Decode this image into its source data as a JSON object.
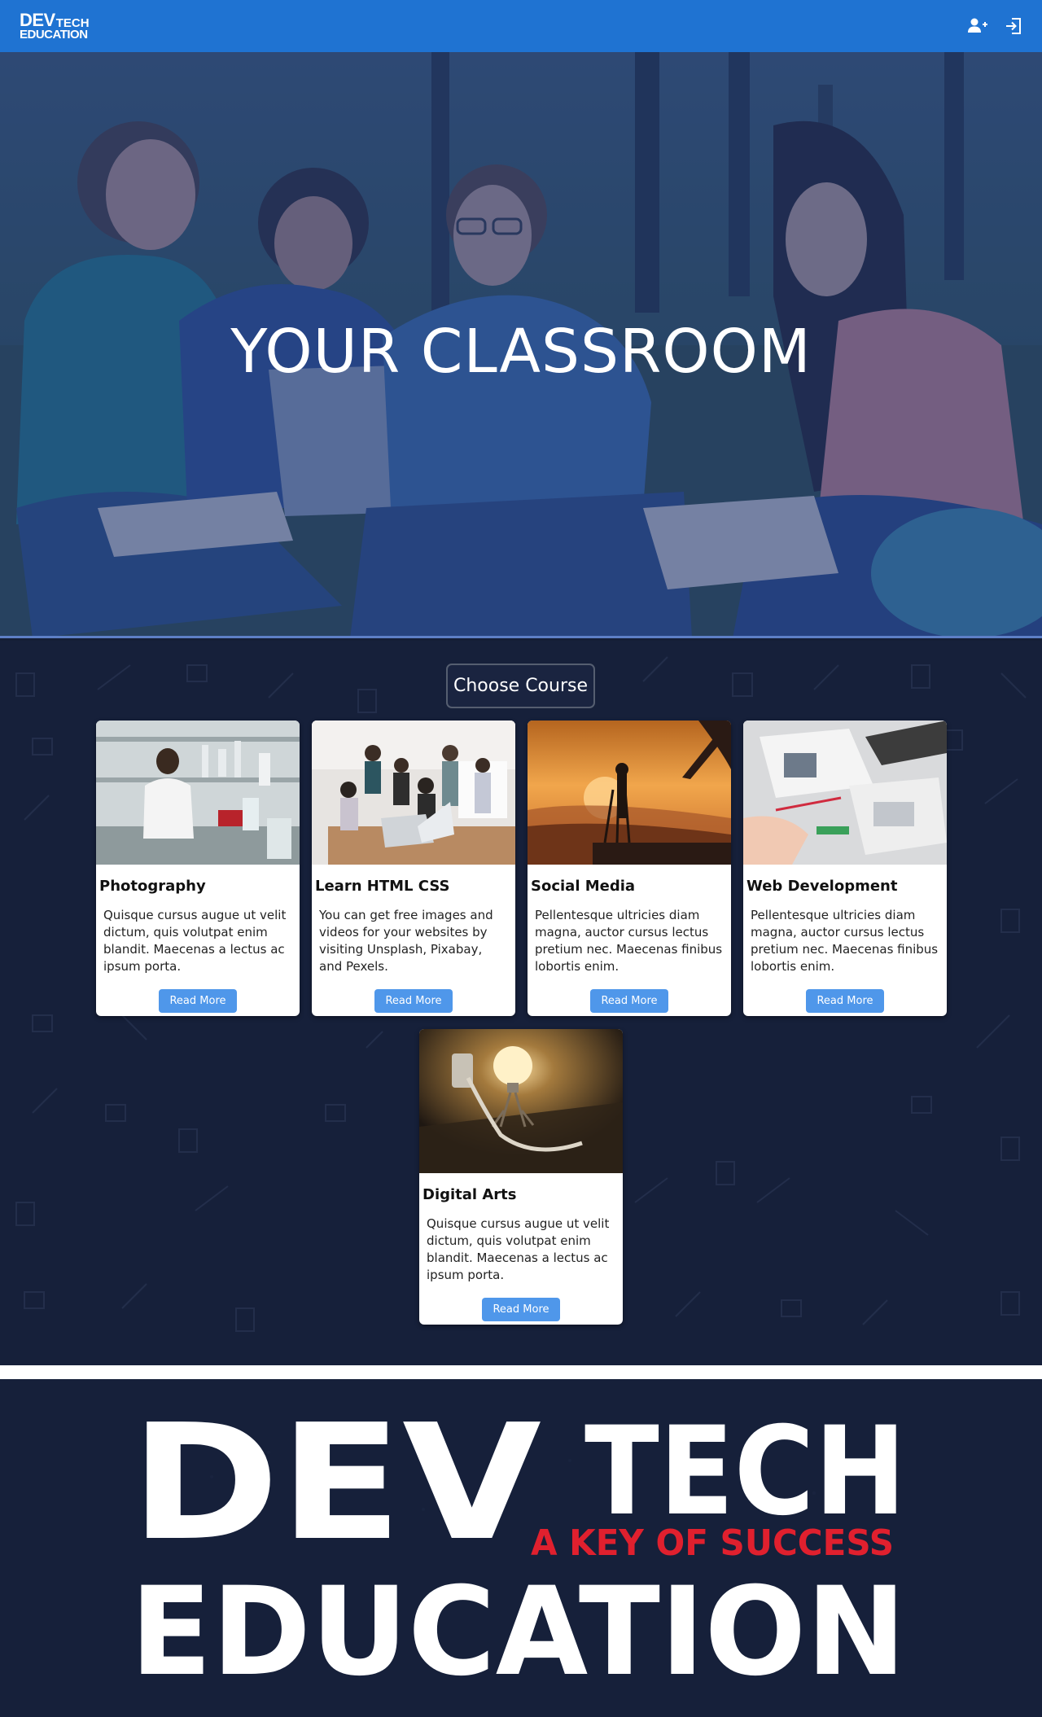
{
  "nav": {
    "logo_dev": "DEV",
    "logo_tech": "TECH",
    "logo_education": "EDUCATION",
    "icons": [
      "add-user-icon",
      "sign-in-icon"
    ],
    "background_color": "#1f73d2"
  },
  "hero": {
    "title": "YOUR CLASSROOM"
  },
  "courses": {
    "choose_label": "Choose Course",
    "read_more_label": "Read More",
    "items": [
      {
        "title": "Photography",
        "text": "Quisque cursus augue ut velit dictum, quis volutpat enim blandit. Maecenas a lectus ac ipsum porta.",
        "button": "Read More"
      },
      {
        "title": "Learn HTML CSS",
        "text": "You can get free images and videos for your websites by visiting Unsplash, Pixabay, and Pexels.",
        "button": "Read More"
      },
      {
        "title": "Social Media",
        "text": "Pellentesque ultricies diam magna, auctor cursus lectus pretium nec. Maecenas finibus lobortis enim.",
        "button": "Read More"
      },
      {
        "title": "Web Development",
        "text": "Pellentesque ultricies diam magna, auctor cursus lectus pretium nec. Maecenas finibus lobortis enim.",
        "button": "Read More"
      },
      {
        "title": "Digital Arts",
        "text": "Quisque cursus augue ut velit dictum, quis volutpat enim blandit. Maecenas a lectus ac ipsum porta.",
        "button": "Read More"
      }
    ],
    "button_color": "#4f97ea",
    "section_background": "#16203a"
  },
  "footer": {
    "logo_dev": "DEV",
    "logo_tech": "TECH",
    "logo_education": "EDUCATION",
    "tagline": "A KEY OF SUCCESS",
    "tagline_color": "#e0202e"
  }
}
